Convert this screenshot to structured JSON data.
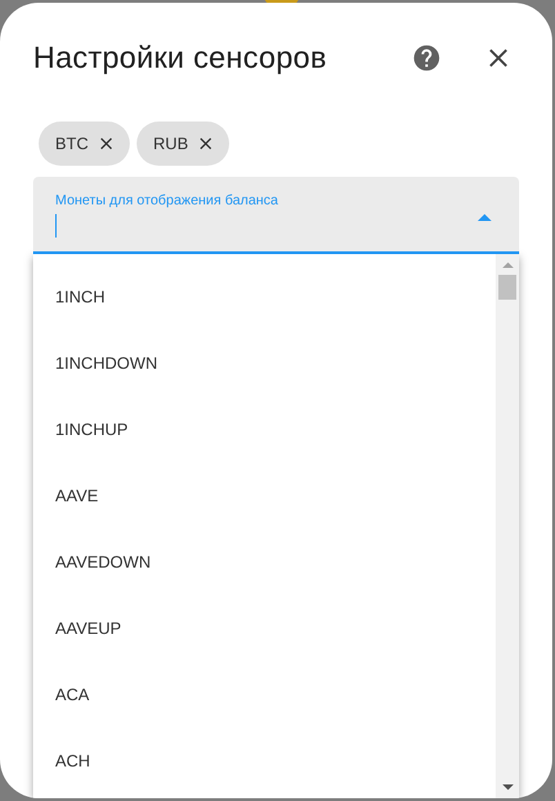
{
  "dialog": {
    "title": "Настройки сенсоров",
    "chips": [
      {
        "label": "BTC"
      },
      {
        "label": "RUB"
      }
    ],
    "field": {
      "label": "Монеты для отображения баланса"
    },
    "options": [
      "1INCH",
      "1INCHDOWN",
      "1INCHUP",
      "AAVE",
      "AAVEDOWN",
      "AAVEUP",
      "ACA",
      "ACH"
    ]
  }
}
